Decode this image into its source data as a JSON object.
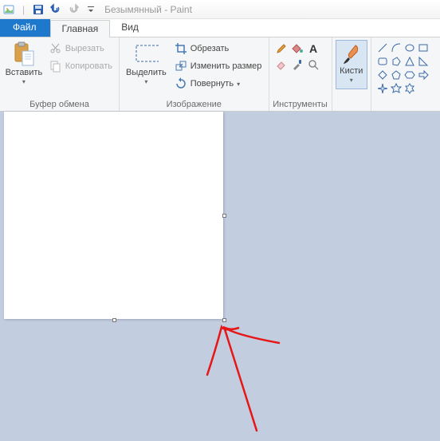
{
  "title": {
    "doc": "Безымянный",
    "app": "Paint"
  },
  "tabs": {
    "file": "Файл",
    "home": "Главная",
    "view": "Вид"
  },
  "clipboard": {
    "paste": "Вставить",
    "cut": "Вырезать",
    "copy": "Копировать",
    "group": "Буфер обмена"
  },
  "image": {
    "select": "Выделить",
    "crop": "Обрезать",
    "resize": "Изменить размер",
    "rotate": "Повернуть",
    "group": "Изображение"
  },
  "tools": {
    "group": "Инструменты"
  },
  "brushes": {
    "label": "Кисти"
  }
}
